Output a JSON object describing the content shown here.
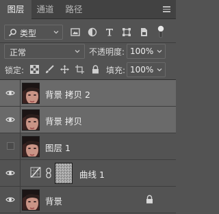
{
  "tabs": [
    {
      "label": "图层",
      "active": true
    },
    {
      "label": "通道",
      "active": false
    },
    {
      "label": "路径",
      "active": false
    }
  ],
  "filter": {
    "kind_label": "类型",
    "icons": [
      "pixel-filter-icon",
      "adjustment-filter-icon",
      "type-filter-icon",
      "shape-filter-icon",
      "smart-object-filter-icon",
      "filter-toggle-icon"
    ]
  },
  "blend": {
    "mode": "正常",
    "opacity_label": "不透明度:",
    "opacity_value": "100%"
  },
  "lock": {
    "label": "锁定:",
    "icons": [
      "lock-transparent-icon",
      "lock-paint-icon",
      "lock-position-icon",
      "lock-artboard-icon",
      "lock-all-icon"
    ],
    "fill_label": "填充:",
    "fill_value": "100%"
  },
  "layers": [
    {
      "name": "背景 拷贝 2",
      "visible": true,
      "selected": true,
      "type": "pixel"
    },
    {
      "name": "背景 拷贝",
      "visible": true,
      "selected": true,
      "type": "pixel"
    },
    {
      "name": "图层 1",
      "visible": false,
      "selected": false,
      "type": "pixel"
    },
    {
      "name": "曲线 1",
      "visible": true,
      "selected": false,
      "type": "adjustment"
    },
    {
      "name": "背景",
      "visible": true,
      "selected": false,
      "type": "pixel",
      "locked": true
    }
  ],
  "colors": {
    "panel_bg": "#535353",
    "tabbar_bg": "#424242",
    "selected_row": "#6a6a6a"
  }
}
